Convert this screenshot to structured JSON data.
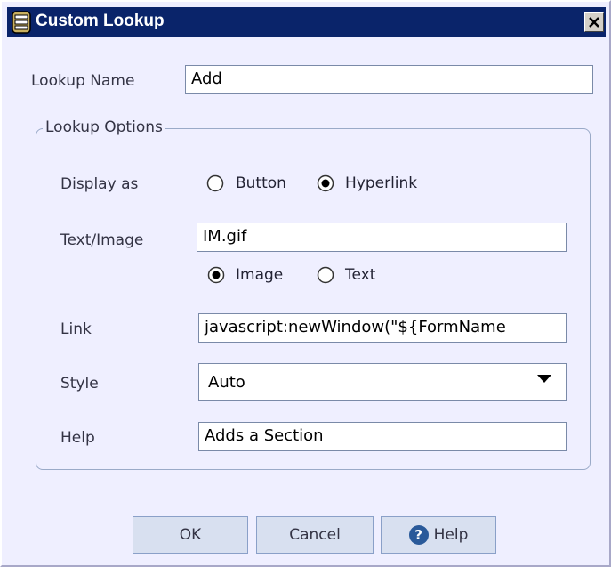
{
  "window": {
    "title": "Custom Lookup",
    "close_glyph": "×"
  },
  "lookup_name": {
    "label": "Lookup Name",
    "value": "Add"
  },
  "options": {
    "legend": "Lookup Options",
    "display_as": {
      "label": "Display as",
      "option_button": "Button",
      "option_hyperlink": "Hyperlink",
      "selected": "Hyperlink"
    },
    "text_image": {
      "label": "Text/Image",
      "value": "IM.gif",
      "option_image": "Image",
      "option_text": "Text",
      "selected": "Image"
    },
    "link": {
      "label": "Link",
      "value": "javascript:newWindow(\"${FormName"
    },
    "style": {
      "label": "Style",
      "value": "Auto"
    },
    "help": {
      "label": "Help",
      "value": "Adds a Section"
    }
  },
  "buttons": {
    "ok": "OK",
    "cancel": "Cancel",
    "help": "Help"
  },
  "icons": {
    "title": "dialog-icon",
    "help": "help-icon",
    "dropdown": "chevron-down-icon"
  }
}
